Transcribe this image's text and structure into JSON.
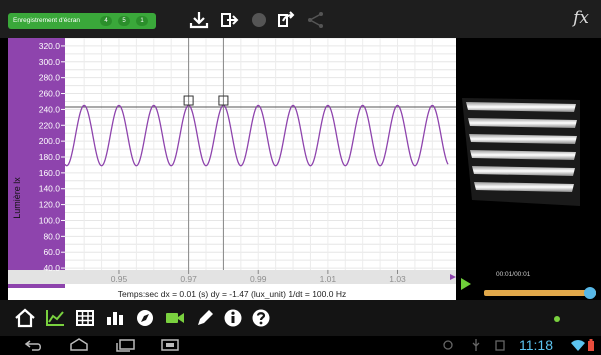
{
  "toolbar": {
    "record_label": "Enregistrement d'écran",
    "record_buttons": [
      "4",
      "5",
      "1"
    ],
    "icons": [
      "download-icon",
      "export-icon",
      "record-icon",
      "share-icon",
      "network-icon"
    ],
    "fx_label": "fx"
  },
  "chart_data": {
    "type": "line",
    "title": "",
    "ylabel": "Lumière lx",
    "xlabel": "Temps:sec",
    "ylim": [
      30,
      330
    ],
    "xlim": [
      0.9345,
      1.0445
    ],
    "yticks": [
      "320.0",
      "300.0",
      "280.0",
      "260.0",
      "240.0",
      "220.0",
      "200.0",
      "180.0",
      "160.0",
      "140.0",
      "120.0",
      "100.0",
      "80.0",
      "60.0",
      "40.0"
    ],
    "xticks": [
      "0.95",
      "0.97",
      "0.99",
      "1.01",
      "1.03"
    ],
    "series": [
      {
        "color": "#8e44ad",
        "mean": 207,
        "amplitude": 38,
        "frequency_hz": 100,
        "phase_peak_x": 0.97
      }
    ],
    "reference_line_y": 243,
    "cursors_x": [
      0.97,
      0.98
    ],
    "grid": true
  },
  "status": {
    "text": "Temps:sec  dx = 0.01 (s) dy = -1.47 (lux_unit)  1/dt = 100.0 Hz"
  },
  "video": {
    "time": "00:01/00:01",
    "progress": 1.0
  },
  "bottom_toolbar": {
    "icons": [
      "home-icon",
      "graph-icon",
      "table-icon",
      "bar-chart-icon",
      "compass-icon",
      "video-icon",
      "pen-icon",
      "info-icon",
      "help-icon"
    ]
  },
  "system": {
    "clock": "11:18"
  },
  "colors": {
    "accent_green": "#3aa83a",
    "axis_purple": "#8e44ad",
    "clock_blue": "#5cc4f0",
    "progress_orange": "#e1a84a"
  }
}
